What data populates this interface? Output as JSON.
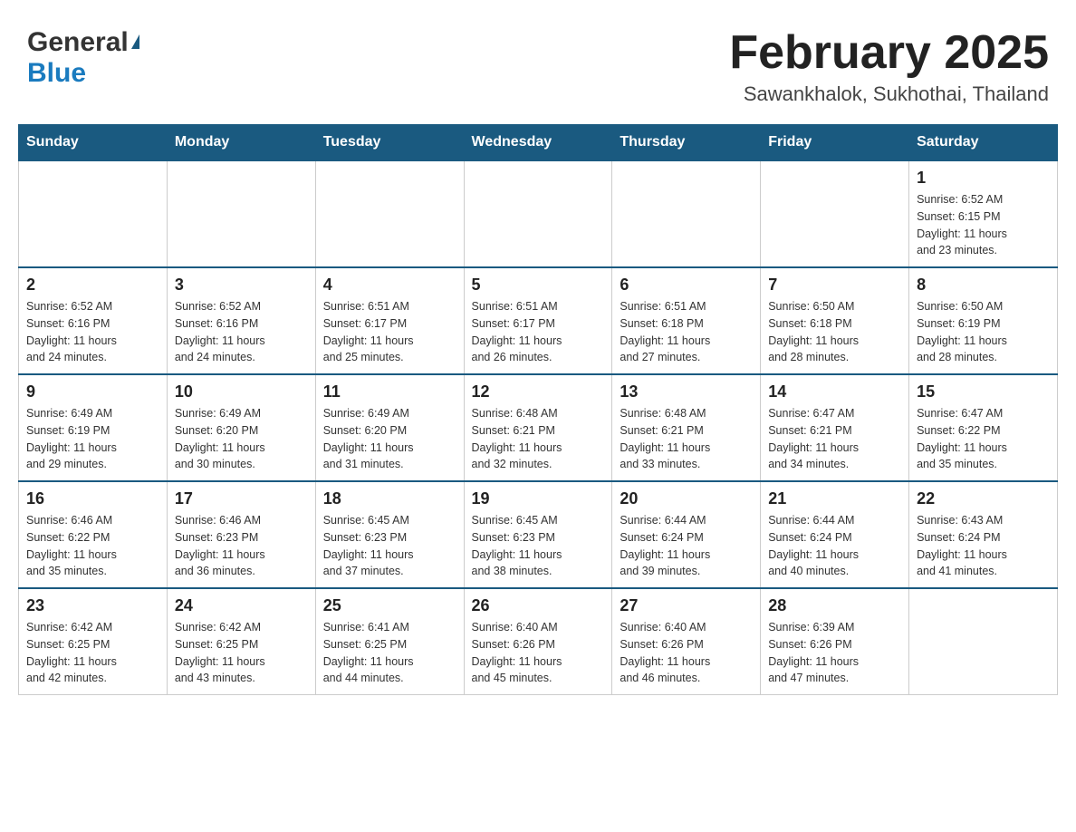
{
  "header": {
    "logo": {
      "general": "General",
      "blue": "Blue",
      "triangle": "▶"
    },
    "title": "February 2025",
    "subtitle": "Sawankhalok, Sukhothai, Thailand"
  },
  "weekdays": [
    "Sunday",
    "Monday",
    "Tuesday",
    "Wednesday",
    "Thursday",
    "Friday",
    "Saturday"
  ],
  "weeks": [
    [
      {
        "day": "",
        "info": ""
      },
      {
        "day": "",
        "info": ""
      },
      {
        "day": "",
        "info": ""
      },
      {
        "day": "",
        "info": ""
      },
      {
        "day": "",
        "info": ""
      },
      {
        "day": "",
        "info": ""
      },
      {
        "day": "1",
        "info": "Sunrise: 6:52 AM\nSunset: 6:15 PM\nDaylight: 11 hours\nand 23 minutes."
      }
    ],
    [
      {
        "day": "2",
        "info": "Sunrise: 6:52 AM\nSunset: 6:16 PM\nDaylight: 11 hours\nand 24 minutes."
      },
      {
        "day": "3",
        "info": "Sunrise: 6:52 AM\nSunset: 6:16 PM\nDaylight: 11 hours\nand 24 minutes."
      },
      {
        "day": "4",
        "info": "Sunrise: 6:51 AM\nSunset: 6:17 PM\nDaylight: 11 hours\nand 25 minutes."
      },
      {
        "day": "5",
        "info": "Sunrise: 6:51 AM\nSunset: 6:17 PM\nDaylight: 11 hours\nand 26 minutes."
      },
      {
        "day": "6",
        "info": "Sunrise: 6:51 AM\nSunset: 6:18 PM\nDaylight: 11 hours\nand 27 minutes."
      },
      {
        "day": "7",
        "info": "Sunrise: 6:50 AM\nSunset: 6:18 PM\nDaylight: 11 hours\nand 28 minutes."
      },
      {
        "day": "8",
        "info": "Sunrise: 6:50 AM\nSunset: 6:19 PM\nDaylight: 11 hours\nand 28 minutes."
      }
    ],
    [
      {
        "day": "9",
        "info": "Sunrise: 6:49 AM\nSunset: 6:19 PM\nDaylight: 11 hours\nand 29 minutes."
      },
      {
        "day": "10",
        "info": "Sunrise: 6:49 AM\nSunset: 6:20 PM\nDaylight: 11 hours\nand 30 minutes."
      },
      {
        "day": "11",
        "info": "Sunrise: 6:49 AM\nSunset: 6:20 PM\nDaylight: 11 hours\nand 31 minutes."
      },
      {
        "day": "12",
        "info": "Sunrise: 6:48 AM\nSunset: 6:21 PM\nDaylight: 11 hours\nand 32 minutes."
      },
      {
        "day": "13",
        "info": "Sunrise: 6:48 AM\nSunset: 6:21 PM\nDaylight: 11 hours\nand 33 minutes."
      },
      {
        "day": "14",
        "info": "Sunrise: 6:47 AM\nSunset: 6:21 PM\nDaylight: 11 hours\nand 34 minutes."
      },
      {
        "day": "15",
        "info": "Sunrise: 6:47 AM\nSunset: 6:22 PM\nDaylight: 11 hours\nand 35 minutes."
      }
    ],
    [
      {
        "day": "16",
        "info": "Sunrise: 6:46 AM\nSunset: 6:22 PM\nDaylight: 11 hours\nand 35 minutes."
      },
      {
        "day": "17",
        "info": "Sunrise: 6:46 AM\nSunset: 6:23 PM\nDaylight: 11 hours\nand 36 minutes."
      },
      {
        "day": "18",
        "info": "Sunrise: 6:45 AM\nSunset: 6:23 PM\nDaylight: 11 hours\nand 37 minutes."
      },
      {
        "day": "19",
        "info": "Sunrise: 6:45 AM\nSunset: 6:23 PM\nDaylight: 11 hours\nand 38 minutes."
      },
      {
        "day": "20",
        "info": "Sunrise: 6:44 AM\nSunset: 6:24 PM\nDaylight: 11 hours\nand 39 minutes."
      },
      {
        "day": "21",
        "info": "Sunrise: 6:44 AM\nSunset: 6:24 PM\nDaylight: 11 hours\nand 40 minutes."
      },
      {
        "day": "22",
        "info": "Sunrise: 6:43 AM\nSunset: 6:24 PM\nDaylight: 11 hours\nand 41 minutes."
      }
    ],
    [
      {
        "day": "23",
        "info": "Sunrise: 6:42 AM\nSunset: 6:25 PM\nDaylight: 11 hours\nand 42 minutes."
      },
      {
        "day": "24",
        "info": "Sunrise: 6:42 AM\nSunset: 6:25 PM\nDaylight: 11 hours\nand 43 minutes."
      },
      {
        "day": "25",
        "info": "Sunrise: 6:41 AM\nSunset: 6:25 PM\nDaylight: 11 hours\nand 44 minutes."
      },
      {
        "day": "26",
        "info": "Sunrise: 6:40 AM\nSunset: 6:26 PM\nDaylight: 11 hours\nand 45 minutes."
      },
      {
        "day": "27",
        "info": "Sunrise: 6:40 AM\nSunset: 6:26 PM\nDaylight: 11 hours\nand 46 minutes."
      },
      {
        "day": "28",
        "info": "Sunrise: 6:39 AM\nSunset: 6:26 PM\nDaylight: 11 hours\nand 47 minutes."
      },
      {
        "day": "",
        "info": ""
      }
    ]
  ]
}
